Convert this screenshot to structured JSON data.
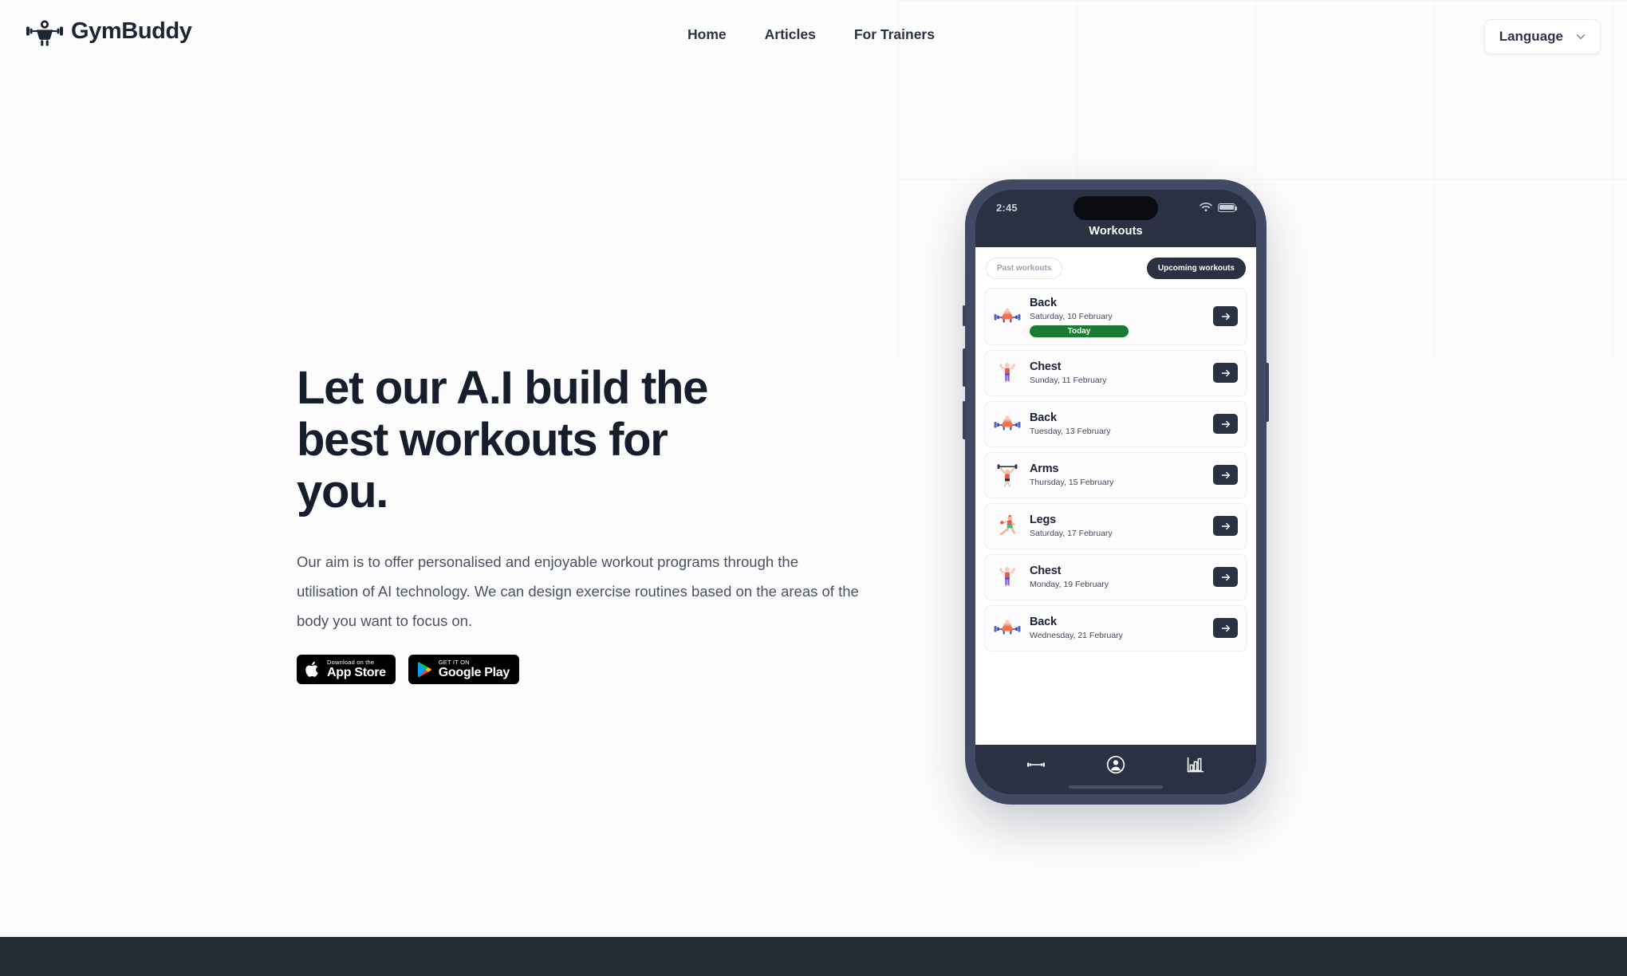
{
  "brand": {
    "name": "GymBuddy",
    "logo_icon": "weightlifter-icon"
  },
  "header": {
    "nav": [
      {
        "label": "Home",
        "name": "nav-home"
      },
      {
        "label": "Articles",
        "name": "nav-articles"
      },
      {
        "label": "For Trainers",
        "name": "nav-for-trainers"
      }
    ],
    "language": {
      "label": "Language",
      "icon": "chevron-down-icon"
    }
  },
  "hero": {
    "title": "Let our A.I build the best workouts for you.",
    "paragraph": "Our aim is to offer personalised and enjoyable workout programs through the utilisation of AI technology. We can design exercise routines based on the areas of the body you want to focus on.",
    "badges": [
      {
        "small": "Download on the",
        "big": "App Store",
        "icon": "apple-icon"
      },
      {
        "small": "GET IT ON",
        "big": "Google Play",
        "icon": "google-play-icon"
      }
    ]
  },
  "phone": {
    "status": {
      "time": "2:45",
      "wifi_icon": "wifi-icon",
      "battery_icon": "battery-icon"
    },
    "app_title": "Workouts",
    "tabs": [
      {
        "label": "Past workouts",
        "active": false
      },
      {
        "label": "Upcoming workouts",
        "active": true
      }
    ],
    "workouts": [
      {
        "name": "Back",
        "date": "Saturday, 10 February",
        "badge": "Today",
        "icon": "bench-press-icon",
        "arrow": "arrow-right-icon"
      },
      {
        "name": "Chest",
        "date": "Sunday, 11 February",
        "badge": "",
        "icon": "flexing-icon",
        "arrow": "arrow-right-icon"
      },
      {
        "name": "Back",
        "date": "Tuesday, 13 February",
        "badge": "",
        "icon": "bench-press-icon",
        "arrow": "arrow-right-icon"
      },
      {
        "name": "Arms",
        "date": "Thursday, 15 February",
        "badge": "",
        "icon": "overhead-press-icon",
        "arrow": "arrow-right-icon"
      },
      {
        "name": "Legs",
        "date": "Saturday, 17 February",
        "badge": "",
        "icon": "lunge-icon",
        "arrow": "arrow-right-icon"
      },
      {
        "name": "Chest",
        "date": "Monday, 19 February",
        "badge": "",
        "icon": "flexing-icon",
        "arrow": "arrow-right-icon"
      },
      {
        "name": "Back",
        "date": "Wednesday, 21 February",
        "badge": "",
        "icon": "bench-press-icon",
        "arrow": "arrow-right-icon"
      }
    ],
    "tabbar": [
      {
        "icon": "dumbbell-icon",
        "name": "tabbar-workouts"
      },
      {
        "icon": "person-circle-icon",
        "name": "tabbar-profile"
      },
      {
        "icon": "bar-chart-icon",
        "name": "tabbar-stats"
      }
    ]
  },
  "colors": {
    "page_bg": "#fcfcfd",
    "ink": "#161e2e",
    "body_text": "#4a5262",
    "phone_frame": "#414a63",
    "phone_screen_dark": "#2a3142",
    "today_green": "#1c7a32",
    "footer": "#242c36"
  }
}
